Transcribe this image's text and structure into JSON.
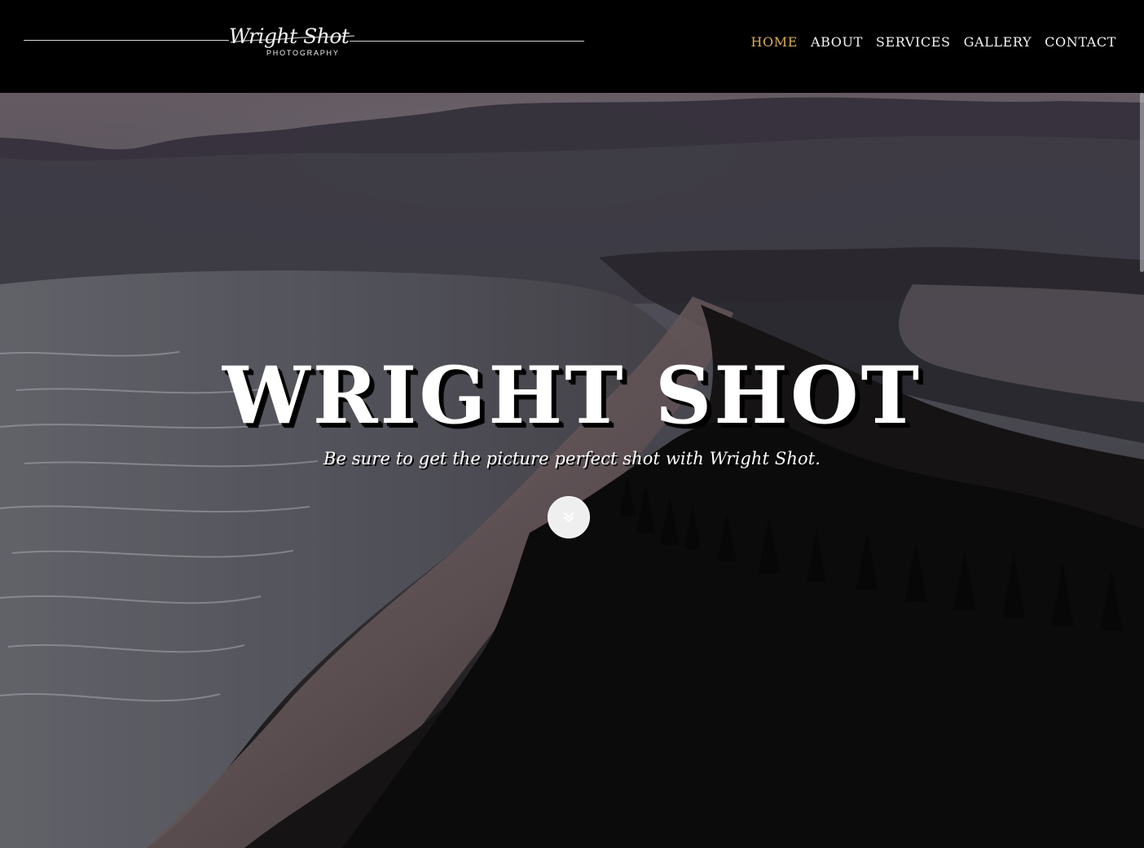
{
  "brand": {
    "script": "Wright Shot",
    "sub": "PHOTOGRAPHY"
  },
  "nav": {
    "items": [
      {
        "label": "HOME",
        "active": true
      },
      {
        "label": "ABOUT",
        "active": false
      },
      {
        "label": "SERVICES",
        "active": false
      },
      {
        "label": "GALLERY",
        "active": false
      },
      {
        "label": "CONTACT",
        "active": false
      }
    ]
  },
  "hero": {
    "title": "WRIGHT SHOT",
    "subtitle": "Be sure to get the picture perfect shot with Wright Shot.",
    "scroll_icon": "double-chevron-down-icon"
  },
  "colors": {
    "header_bg": "#000000",
    "nav_text": "#f5f5f5",
    "nav_active": "#d8ad55"
  }
}
